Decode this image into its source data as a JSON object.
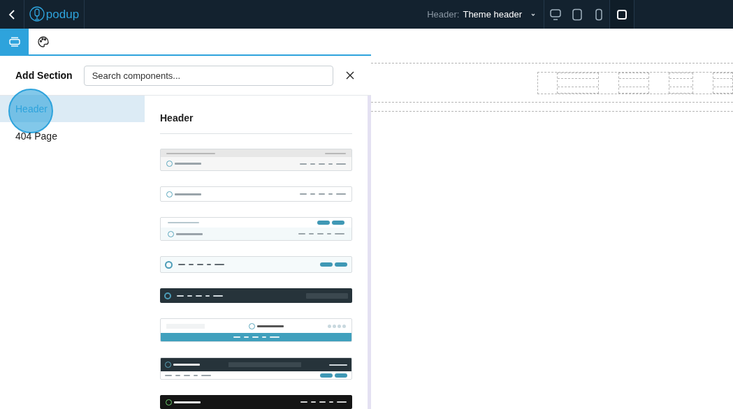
{
  "topbar": {
    "logo_text": "podup",
    "header_label": "Header:",
    "header_value": "Theme header",
    "devices": [
      {
        "kind": "desktop",
        "selected": false
      },
      {
        "kind": "tablet",
        "selected": false
      },
      {
        "kind": "phone",
        "selected": false
      },
      {
        "kind": "fit",
        "selected": true
      }
    ]
  },
  "toolbar": {
    "tabs": [
      {
        "kind": "sections",
        "selected": true
      },
      {
        "kind": "styles",
        "selected": false
      }
    ]
  },
  "panel": {
    "title": "Add Section",
    "search": {
      "placeholder": "Search components..."
    },
    "categories": [
      {
        "label": "Header",
        "selected": true,
        "highlighted": true
      },
      {
        "label": "404 Page",
        "selected": false,
        "highlighted": false
      }
    ],
    "group_title": "Header",
    "templates": [
      {
        "kind": "topbar-light"
      },
      {
        "kind": "light"
      },
      {
        "kind": "light-login"
      },
      {
        "kind": "light-buttons"
      },
      {
        "kind": "dark-search"
      },
      {
        "kind": "center-logo"
      },
      {
        "kind": "dark-two-row"
      },
      {
        "kind": "black"
      }
    ]
  }
}
